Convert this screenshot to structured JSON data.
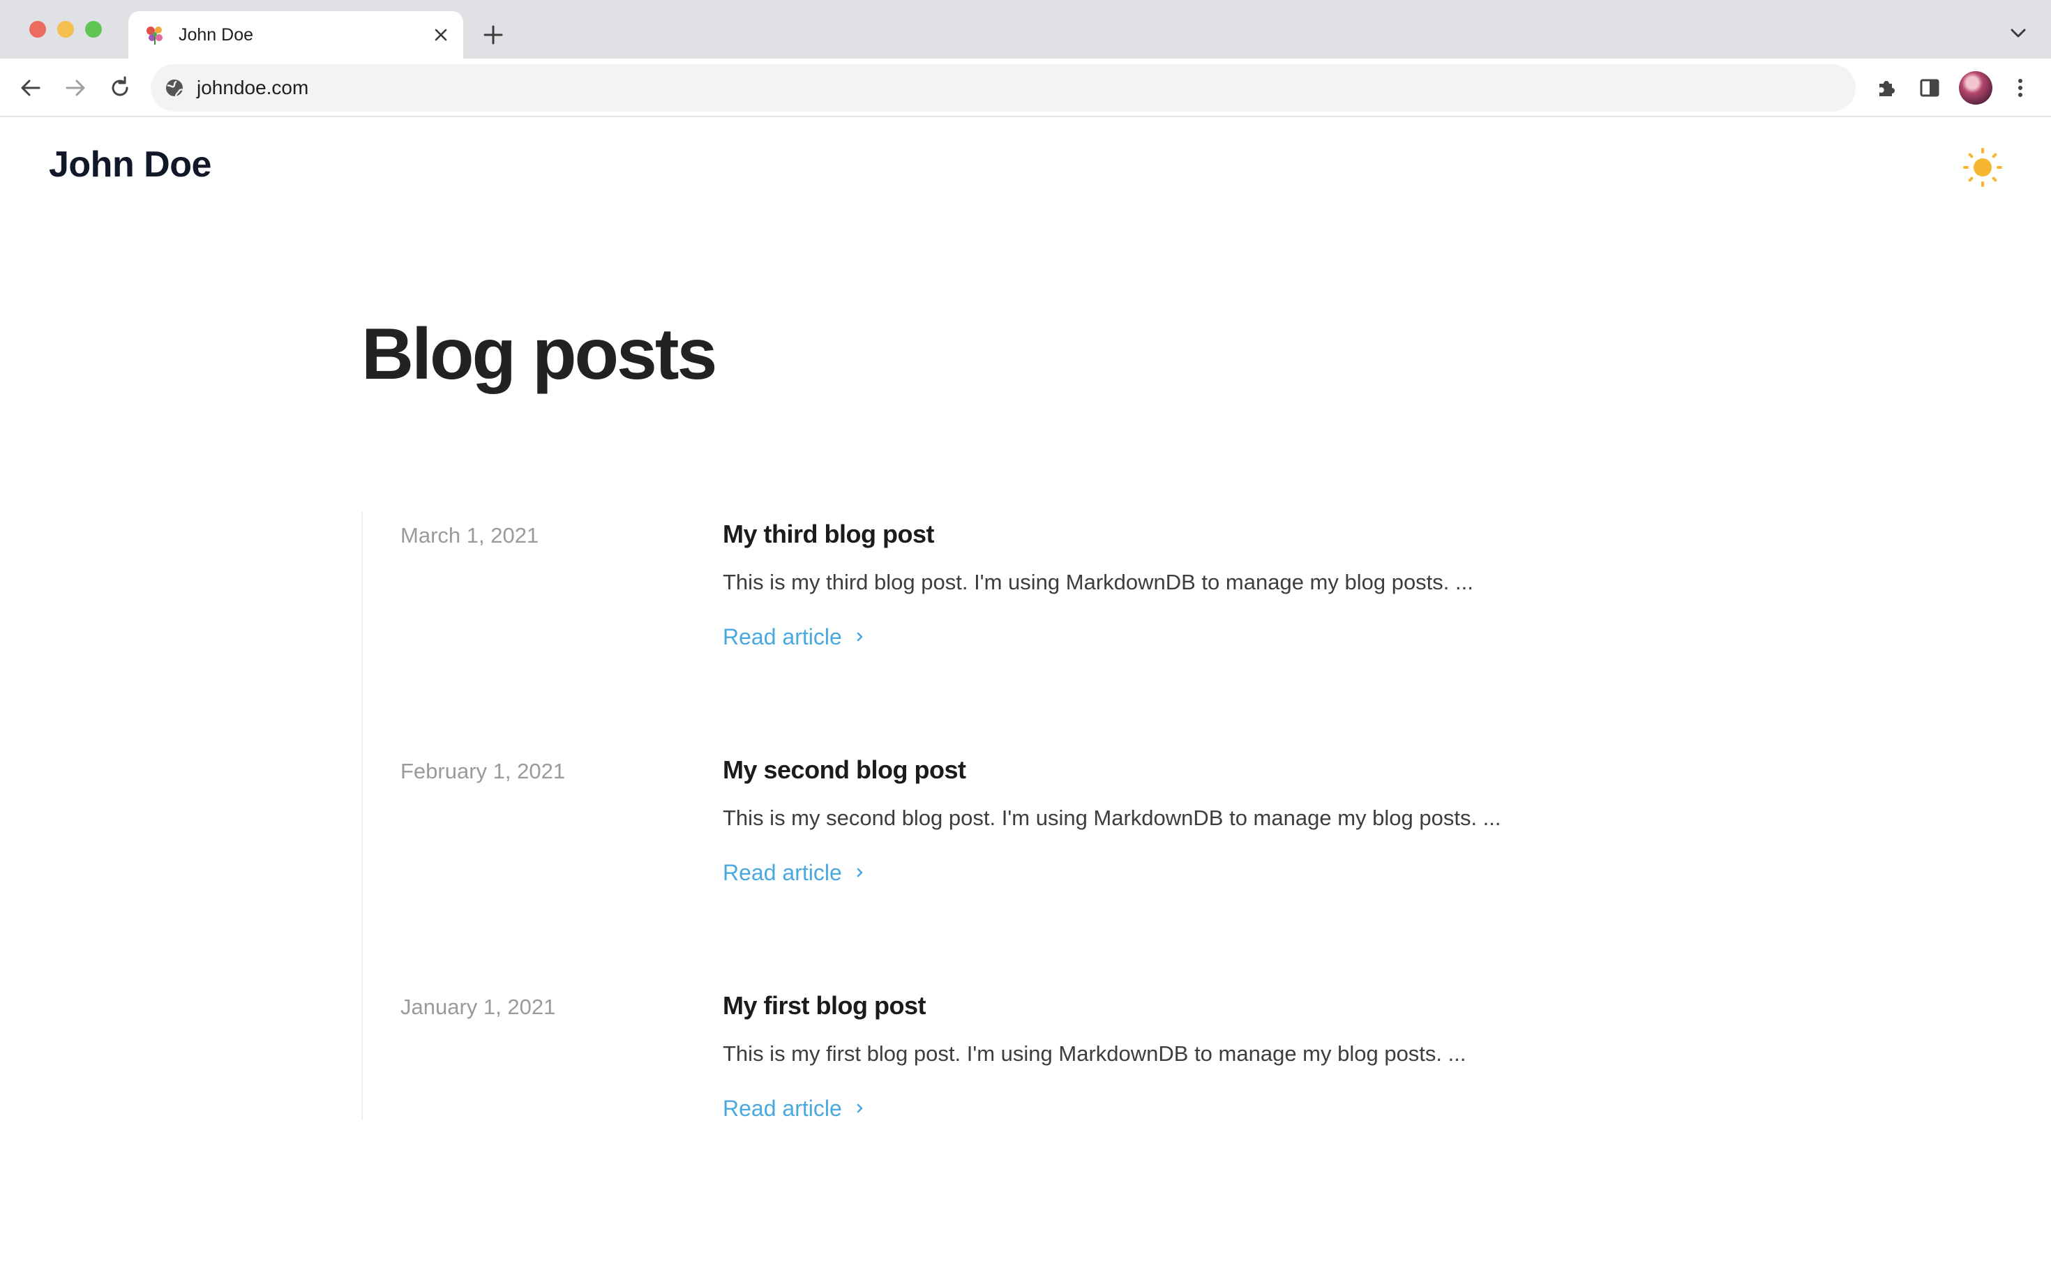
{
  "browser": {
    "tab": {
      "title": "John Doe",
      "favicon": "flower-icon"
    },
    "address_bar": {
      "url": "johndoe.com",
      "site_info_icon": "globe-icon"
    },
    "toolbar_icons": [
      "back-arrow-icon",
      "forward-arrow-icon",
      "reload-icon",
      "extensions-puzzle-icon",
      "side-panel-icon",
      "profile-avatar",
      "kebab-menu-icon"
    ],
    "colors": {
      "tabstrip_bg": "#dfe1e5",
      "omnibox_bg": "#f1f3f4"
    }
  },
  "site": {
    "title": "John Doe",
    "theme_toggle_icon": "sun-icon",
    "theme_toggle_color": "#f5b731"
  },
  "main": {
    "heading": "Blog posts",
    "read_more_color": "#4aa8e0",
    "posts": [
      {
        "date": "March 1, 2021",
        "title": "My third blog post",
        "excerpt": "This is my third blog post. I'm using MarkdownDB to manage my blog posts. ...",
        "link_label": "Read article"
      },
      {
        "date": "February 1, 2021",
        "title": "My second blog post",
        "excerpt": "This is my second blog post. I'm using MarkdownDB to manage my blog posts. ...",
        "link_label": "Read article"
      },
      {
        "date": "January 1, 2021",
        "title": "My first blog post",
        "excerpt": "This is my first blog post. I'm using MarkdownDB to manage my blog posts. ...",
        "link_label": "Read article"
      }
    ]
  }
}
